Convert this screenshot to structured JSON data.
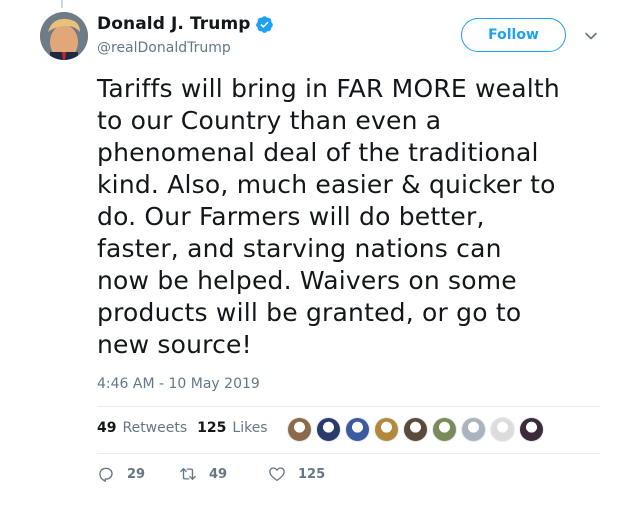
{
  "author": {
    "name": "Donald J. Trump",
    "handle": "@realDonaldTrump",
    "verified_color": "#1da1f2"
  },
  "follow_label": "Follow",
  "tweet": {
    "text": "Tariffs will bring in FAR MORE wealth\nto our Country than even a\nphenomenal deal of the traditional\nkind. Also, much easier & quicker to\ndo. Our Farmers will do better,\nfaster, and starving nations can\nnow be helped. Waivers on some\nproducts will be granted, or go to\nnew source!",
    "timestamp": "4:46 AM - 10 May 2019"
  },
  "stats": {
    "retweets_count": "49",
    "retweets_label": "Retweets",
    "likes_count": "125",
    "likes_label": "Likes"
  },
  "likers": [
    {
      "color": "#8a6a4a"
    },
    {
      "color": "#2a3a6a"
    },
    {
      "color": "#3c5aa0"
    },
    {
      "color": "#b08a3a"
    },
    {
      "color": "#5a4a3a"
    },
    {
      "color": "#7a8a5a"
    },
    {
      "color": "#aab4be"
    },
    {
      "color": "#dcdcdc"
    },
    {
      "color": "#3a2a3a"
    }
  ],
  "actions": {
    "reply_count": "29",
    "retweet_count": "49",
    "like_count": "125"
  },
  "icons": [
    "verified-icon",
    "chevron-down-icon",
    "reply-icon",
    "retweet-icon",
    "heart-icon"
  ]
}
